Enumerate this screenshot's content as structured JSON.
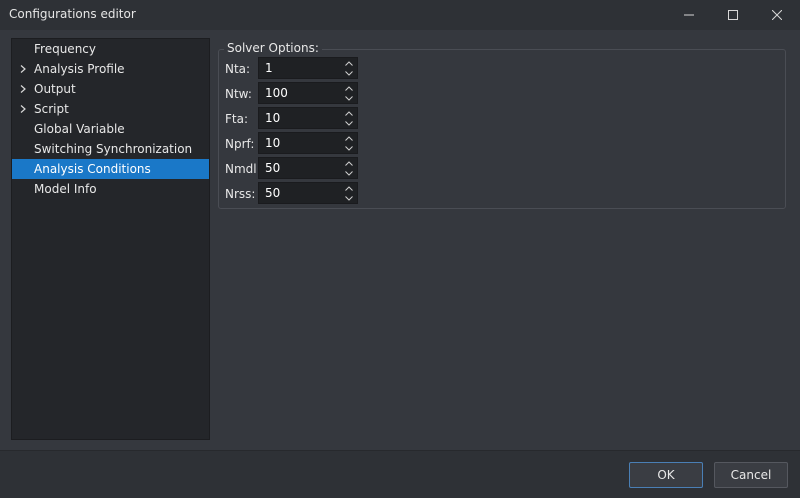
{
  "window": {
    "title": "Configurations editor"
  },
  "tree": {
    "items": [
      {
        "label": "Frequency",
        "expandable": false,
        "selected": false
      },
      {
        "label": "Analysis Profile",
        "expandable": true,
        "selected": false
      },
      {
        "label": "Output",
        "expandable": true,
        "selected": false
      },
      {
        "label": "Script",
        "expandable": true,
        "selected": false
      },
      {
        "label": "Global Variable",
        "expandable": false,
        "selected": false
      },
      {
        "label": "Switching Synchronization",
        "expandable": false,
        "selected": false
      },
      {
        "label": "Analysis Conditions",
        "expandable": false,
        "selected": true
      },
      {
        "label": "Model Info",
        "expandable": false,
        "selected": false
      }
    ]
  },
  "solver": {
    "title": "Solver Options:",
    "fields": [
      {
        "label": "Nta:",
        "value": "1"
      },
      {
        "label": "Ntw:",
        "value": "100"
      },
      {
        "label": "Fta:",
        "value": "10"
      },
      {
        "label": "Nprf:",
        "value": "10"
      },
      {
        "label": "Nmdl:",
        "value": "50"
      },
      {
        "label": "Nrss:",
        "value": "50"
      }
    ]
  },
  "footer": {
    "ok_label": "OK",
    "cancel_label": "Cancel"
  },
  "colors": {
    "selection": "#1a78c8",
    "background": "#35383e",
    "panel": "#24262a"
  }
}
